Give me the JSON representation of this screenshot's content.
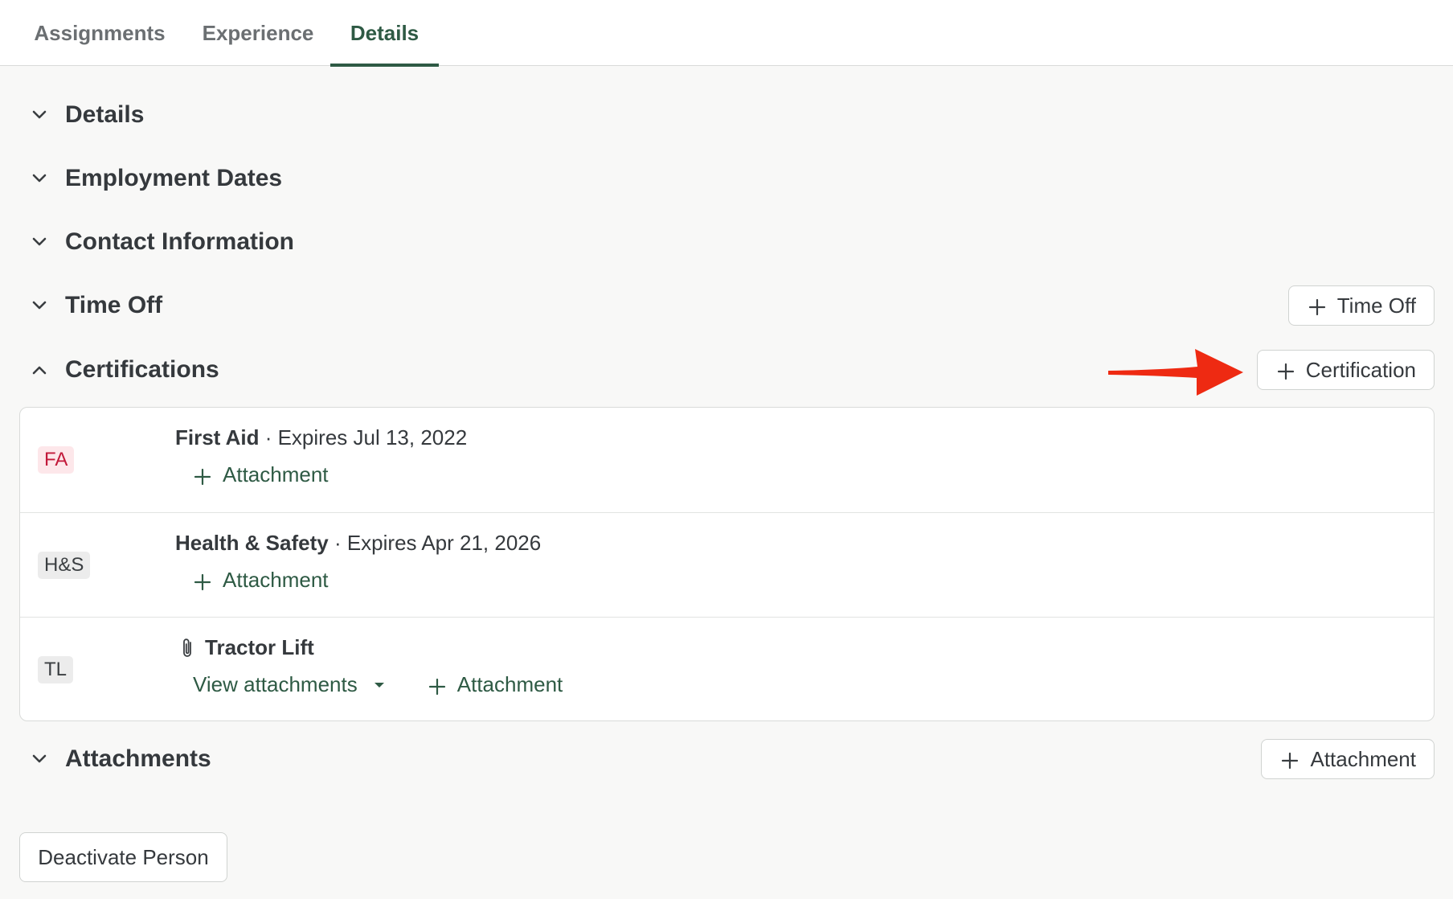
{
  "tabs": [
    {
      "label": "Assignments",
      "active": false
    },
    {
      "label": "Experience",
      "active": false
    },
    {
      "label": "Details",
      "active": true
    }
  ],
  "sections": {
    "details": {
      "title": "Details",
      "expanded": false
    },
    "employment_dates": {
      "title": "Employment Dates",
      "expanded": false
    },
    "contact_information": {
      "title": "Contact Information",
      "expanded": false
    },
    "time_off": {
      "title": "Time Off",
      "expanded": false,
      "button_label": "Time Off"
    },
    "certifications": {
      "title": "Certifications",
      "expanded": true,
      "button_label": "Certification"
    },
    "attachments": {
      "title": "Attachments",
      "expanded": false,
      "button_label": "Attachment"
    }
  },
  "certifications": [
    {
      "badge": "FA",
      "name": "First Aid",
      "expiry": " · Expires Jul 13, 2022",
      "attachment_label": "Attachment",
      "badge_color": "#c2193a"
    },
    {
      "badge": "H&S",
      "name": "Health & Safety",
      "expiry": " · Expires Apr 21, 2026",
      "attachment_label": "Attachment"
    },
    {
      "badge": "TL",
      "name": "Tractor Lift",
      "expiry": "",
      "view_label": "View attachments",
      "attachment_label": "Attachment",
      "has_attachment": true
    }
  ],
  "footer": {
    "deactivate_label": "Deactivate Person"
  },
  "colors": {
    "accent": "#2e5a44",
    "annotation_arrow": "#ee2a12",
    "expired_badge": "#c2193a"
  }
}
